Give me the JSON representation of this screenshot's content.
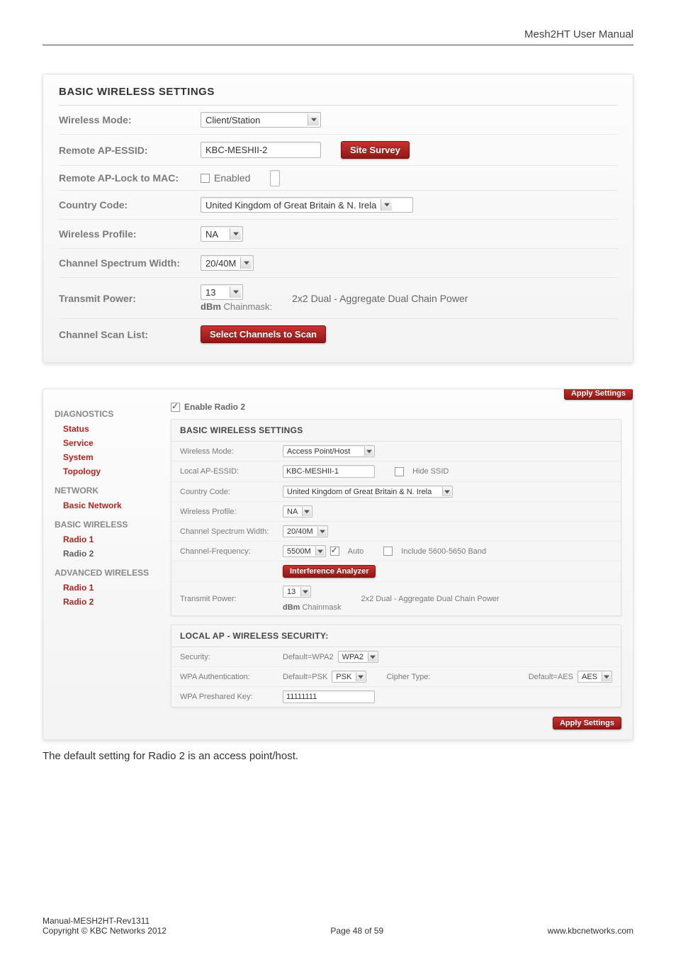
{
  "header": {
    "title": "Mesh2HT User Manual"
  },
  "panel1": {
    "title": "BASIC WIRELESS SETTINGS",
    "wireless_mode_label": "Wireless Mode:",
    "wireless_mode_value": "Client/Station",
    "remote_ap_essid_label": "Remote AP-ESSID:",
    "remote_ap_essid_value": "KBC-MESHII-2",
    "site_survey_btn": "Site Survey",
    "remote_ap_lock_label": "Remote AP-Lock to MAC:",
    "remote_ap_lock_checkbox_label": "Enabled",
    "remote_ap_lock_value": "",
    "country_code_label": "Country Code:",
    "country_code_value": "United Kingdom of Great Britain & N. Irela",
    "wireless_profile_label": "Wireless Profile:",
    "wireless_profile_value": "NA",
    "csw_label": "Channel Spectrum Width:",
    "csw_value": "20/40M",
    "tx_power_label": "Transmit Power:",
    "tx_power_value": "13",
    "chainmask_label_bold": "dBm",
    "chainmask_label_rest": " Chainmask:",
    "tx_power_note": "2x2 Dual - Aggregate Dual Chain Power",
    "scan_list_label": "Channel Scan List:",
    "scan_list_btn": "Select Channels to Scan"
  },
  "panel2": {
    "apply_btn": "Apply Settings",
    "sidebar": {
      "diagnostics": "DIAGNOSTICS",
      "status": "Status",
      "service": "Service",
      "system": "System",
      "topology": "Topology",
      "network": "NETWORK",
      "basic_network": "Basic Network",
      "basic_wireless": "BASIC WIRELESS",
      "bw_radio1": "Radio 1",
      "bw_radio2": "Radio 2",
      "adv_wireless": "ADVANCED WIRELESS",
      "aw_radio1": "Radio 1",
      "aw_radio2": "Radio 2"
    },
    "enable_label": "Enable Radio 2",
    "bws": {
      "title": "BASIC WIRELESS SETTINGS",
      "wireless_mode_label": "Wireless Mode:",
      "wireless_mode_value": "Access Point/Host",
      "local_ap_essid_label": "Local AP-ESSID:",
      "local_ap_essid_value": "KBC-MESHII-1",
      "hide_ssid_label": "Hide SSID",
      "country_code_label": "Country Code:",
      "country_code_value": "United Kingdom of Great Britain & N. Irela",
      "wireless_profile_label": "Wireless Profile:",
      "wireless_profile_value": "NA",
      "csw_label": "Channel Spectrum Width:",
      "csw_value": "20/40M",
      "cf_label": "Channel-Frequency:",
      "cf_value": "5500M",
      "cf_auto_label": "Auto",
      "cf_band_label": "Include 5600-5650 Band",
      "ia_btn": "Interference Analyzer",
      "tx_power_label": "Transmit Power:",
      "tx_power_value": "13",
      "chainmask_label_bold": "dBm",
      "chainmask_label_rest": " Chainmask",
      "tx_power_note": "2x2 Dual - Aggregate Dual Chain Power"
    },
    "sec": {
      "title": "LOCAL AP - WIRELESS SECURITY:",
      "security_label": "Security:",
      "security_prefix": "Default=WPA2",
      "security_value": "WPA2",
      "wpa_auth_label": "WPA Authentication:",
      "wpa_auth_prefix": "Default=PSK",
      "wpa_auth_value": "PSK",
      "cipher_type_label": "Cipher Type:",
      "cipher_prefix": "Default=AES",
      "cipher_value": "AES",
      "preshared_label": "WPA Preshared Key:",
      "preshared_value": "11111111"
    }
  },
  "caption": "The default setting for Radio 2 is an access point/host.",
  "footer": {
    "line1_left": "Manual-MESH2HT-Rev1311",
    "line2_left": "Copyright © KBC Networks 2012",
    "center": "Page 48 of 59",
    "right": "www.kbcnetworks.com"
  }
}
